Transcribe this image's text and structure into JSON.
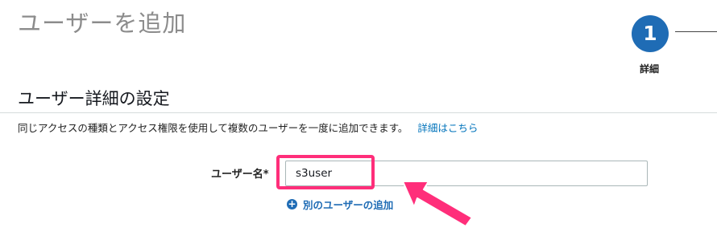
{
  "header": {
    "title": "ユーザーを追加"
  },
  "stepper": {
    "step_number": "1",
    "step_label": "詳細"
  },
  "section": {
    "title": "ユーザー詳細の設定",
    "description": "同じアクセスの種類とアクセス権限を使用して複数のユーザーを一度に追加できます。",
    "learn_more": "詳細はこちら"
  },
  "form": {
    "username_label": "ユーザー名",
    "required_mark": "*",
    "username_value": "s3user",
    "add_another_user": "別のユーザーの追加"
  },
  "annotation": {
    "color": "#ff2e7a"
  },
  "colors": {
    "accent": "#1f6cb5",
    "link": "#0073bb"
  },
  "icons": {
    "plus": "plus-circle-icon"
  }
}
